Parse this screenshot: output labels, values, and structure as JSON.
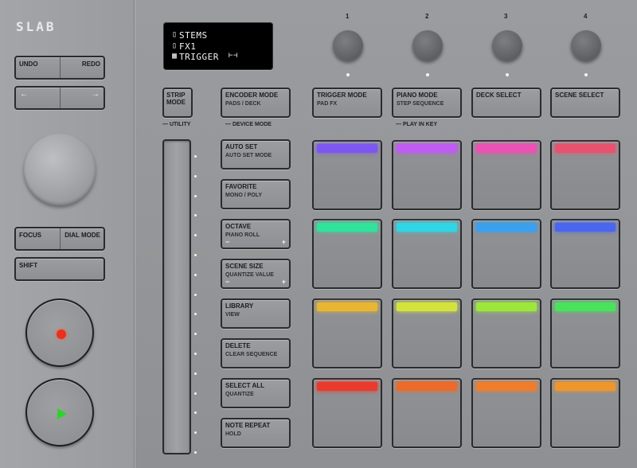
{
  "brand": "SLAB",
  "left": {
    "undo": "UNDO",
    "redo": "REDO",
    "left_arrow": "←",
    "right_arrow": "→",
    "focus": "FOCUS",
    "dial_mode": "DIAL MODE",
    "shift": "SHIFT",
    "icons": {
      "record": "record-icon",
      "play": "play-icon"
    },
    "record_color": "#e8321c",
    "play_color": "#2dd32a"
  },
  "display": {
    "lines": [
      "STEMS",
      "FX1",
      "TRIGGER"
    ],
    "icons": [
      "▯",
      "▯",
      "▦"
    ],
    "trail": "⊢⊣"
  },
  "encoders": [
    "1",
    "2",
    "3",
    "4"
  ],
  "strip_mode": {
    "label": "STRIP MODE",
    "group": "UTILITY"
  },
  "buttons": {
    "encoder_mode": {
      "label": "ENCODER MODE",
      "sub": "PADS / DECK"
    },
    "device_mode": "DEVICE MODE",
    "trigger_mode": {
      "label": "TRIGGER MODE",
      "sub": "PAD FX"
    },
    "piano_mode": {
      "label": "PIANO MODE",
      "sub": "STEP SEQUENCE"
    },
    "deck_select": {
      "label": "DECK SELECT"
    },
    "scene_select": {
      "label": "SCENE SELECT"
    },
    "play_in_key": "PLAY IN KEY"
  },
  "side_buttons": [
    {
      "label": "AUTO SET",
      "sub": "AUTO SET MODE"
    },
    {
      "label": "FAVORITE",
      "sub": "MONO / POLY"
    },
    {
      "label": "OCTAVE",
      "sub": "PIANO ROLL",
      "minus": "−",
      "plus": "+"
    },
    {
      "label": "SCENE SIZE",
      "sub": "QUANTIZE VALUE",
      "minus": "−",
      "plus": "+"
    },
    {
      "label": "LIBRARY",
      "sub": "VIEW"
    },
    {
      "label": "DELETE",
      "sub": "CLEAR SEQUENCE"
    },
    {
      "label": "SELECT ALL",
      "sub": "QUANTIZE"
    },
    {
      "label": "NOTE REPEAT",
      "sub": "HOLD"
    }
  ],
  "pad_colors": [
    [
      "#7d57f0",
      "#c05bf2",
      "#ec52b4",
      "#e8526e"
    ],
    [
      "#2fe39a",
      "#2fd6e6",
      "#3aa0ee",
      "#4a66ee"
    ],
    [
      "#e9b632",
      "#d4e33c",
      "#9be83a",
      "#48e35a"
    ],
    [
      "#ea3a2e",
      "#ec6a2a",
      "#ee7d2c",
      "#ee962c"
    ]
  ]
}
